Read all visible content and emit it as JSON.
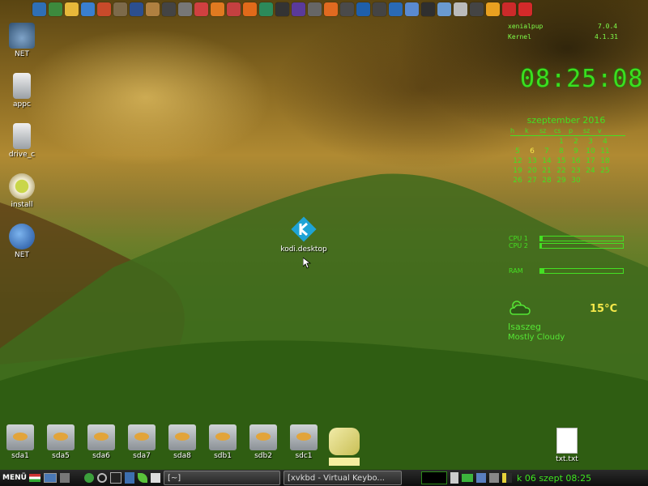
{
  "top_launcher": {
    "icons": [
      "blue-circle-icon",
      "folder-icon",
      "sun-icon",
      "globe-icon",
      "pie-icon",
      "tools-icon",
      "floppy-icon",
      "chip-icon",
      "camera-icon",
      "webcam-icon",
      "pencils-icon",
      "vlc-icon",
      "paint-icon",
      "firefox-icon",
      "spreadsheet-icon",
      "terminal-icon",
      "ball-icon",
      "skull-icon",
      "axe-icon",
      "hex-icon",
      "spiral-icon",
      "camera-icon",
      "slides-icon",
      "window-icon",
      "monitor-icon",
      "mail-icon",
      "cursor-icon",
      "clock-icon",
      "rss-icon",
      "download-icon",
      "power-icon"
    ]
  },
  "desktop_icons": [
    {
      "label": "NET",
      "icon": "network-icon"
    },
    {
      "label": "appc",
      "icon": "server-icon"
    },
    {
      "label": "drive_c",
      "icon": "server-icon"
    },
    {
      "label": "install",
      "icon": "tea-icon"
    },
    {
      "label": "NET",
      "icon": "globe-lightning-icon"
    }
  ],
  "kodi": {
    "label": "kodi.desktop"
  },
  "system": {
    "distro_label": "xenialpup",
    "distro_version": "7.0.4",
    "kernel_label": "Kernel",
    "kernel_version": "4.1.31"
  },
  "clock": "08:25:08",
  "calendar": {
    "title": "szeptember  2016",
    "weekdays": [
      "h",
      "k",
      "sz",
      "cs",
      "p",
      "sz",
      "v"
    ],
    "days": [
      "",
      "",
      "",
      "1",
      "2",
      "3",
      "4",
      "5",
      "6",
      "7",
      "8",
      "9",
      "10",
      "11",
      "12",
      "13",
      "14",
      "15",
      "16",
      "17",
      "18",
      "19",
      "20",
      "21",
      "22",
      "23",
      "24",
      "25",
      "26",
      "27",
      "28",
      "29",
      "30",
      "",
      ""
    ],
    "today": "6"
  },
  "meters": [
    {
      "label": "CPU 1",
      "value": 0.03
    },
    {
      "label": "CPU 2",
      "value": 0.02
    },
    {
      "label": "RAM",
      "value": 0.05
    }
  ],
  "weather": {
    "temperature": "15°C",
    "city": "Isaszeg",
    "condition": "Mostly Cloudy",
    "icon": "cloud-sun-icon"
  },
  "drives": [
    "sda1",
    "sda5",
    "sda6",
    "sda7",
    "sda8",
    "sdb1",
    "sdb2",
    "sdc1"
  ],
  "txt_file": {
    "label": "txt.txt"
  },
  "taskbar": {
    "menu_label": "MENÜ",
    "tasks": [
      {
        "title": "[~]"
      },
      {
        "title": "[xvkbd - Virtual Keybo..."
      }
    ],
    "clock": "k 06 szept 08:25"
  }
}
